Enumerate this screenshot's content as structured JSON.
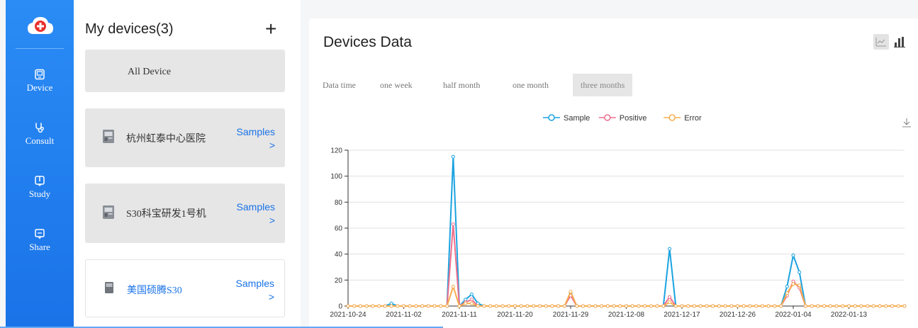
{
  "sidebar": {
    "items": [
      {
        "label": "Device",
        "icon": "device-icon"
      },
      {
        "label": "Consult",
        "icon": "stethoscope-icon"
      },
      {
        "label": "Study",
        "icon": "book-icon"
      },
      {
        "label": "Share",
        "icon": "share-icon"
      }
    ]
  },
  "devices": {
    "title": "My devices(3)",
    "add": "+",
    "all_label": "All Device",
    "items": [
      {
        "name": "杭州虹泰中心医院",
        "samples": "Samples",
        "arrow": ">"
      },
      {
        "name": "S30科宝研发1号机",
        "samples": "Samples",
        "arrow": ">"
      },
      {
        "name": "美国硕腾S30",
        "samples": "Samples",
        "arrow": ">"
      }
    ]
  },
  "panel": {
    "title": "Devices Data",
    "filter_label": "Data time",
    "filters": [
      "one week",
      "half month",
      "one month",
      "three months"
    ],
    "active_filter": "three months"
  },
  "colors": {
    "sample": "#1ba3e0",
    "positive": "#ee6f8d",
    "error": "#f6ad4e",
    "accent": "#1a73e8"
  },
  "chart_data": {
    "type": "line",
    "title": "",
    "xlabel": "",
    "ylabel": "",
    "ylim": [
      0,
      120
    ],
    "yticks": [
      0,
      20,
      40,
      60,
      80,
      100,
      120
    ],
    "x_start": "2021-10-24",
    "x_end": "2022-01-22",
    "xticks": [
      "2021-10-24",
      "2021-11-02",
      "2021-11-11",
      "2021-11-20",
      "2021-11-29",
      "2021-12-08",
      "2021-12-17",
      "2021-12-26",
      "2022-01-04",
      "2022-01-13"
    ],
    "legend_position": "top-center",
    "series": [
      {
        "name": "Sample",
        "points": [
          [
            "2021-10-30",
            0
          ],
          [
            "2021-10-31",
            2
          ],
          [
            "2021-11-01",
            0
          ],
          [
            "2021-11-09",
            0
          ],
          [
            "2021-11-10",
            115
          ],
          [
            "2021-11-11",
            0
          ],
          [
            "2021-11-12",
            5
          ],
          [
            "2021-11-13",
            9
          ],
          [
            "2021-11-14",
            2
          ],
          [
            "2021-11-15",
            0
          ],
          [
            "2021-11-28",
            0
          ],
          [
            "2021-11-29",
            10
          ],
          [
            "2021-11-30",
            0
          ],
          [
            "2021-12-14",
            0
          ],
          [
            "2021-12-15",
            44
          ],
          [
            "2021-12-16",
            0
          ],
          [
            "2022-01-02",
            0
          ],
          [
            "2022-01-03",
            15
          ],
          [
            "2022-01-04",
            39
          ],
          [
            "2022-01-05",
            26
          ],
          [
            "2022-01-06",
            0
          ]
        ]
      },
      {
        "name": "Positive",
        "points": [
          [
            "2021-11-09",
            0
          ],
          [
            "2021-11-10",
            63
          ],
          [
            "2021-11-11",
            0
          ],
          [
            "2021-11-12",
            3
          ],
          [
            "2021-11-13",
            5
          ],
          [
            "2021-11-14",
            0
          ],
          [
            "2021-11-28",
            0
          ],
          [
            "2021-11-29",
            8
          ],
          [
            "2021-11-30",
            0
          ],
          [
            "2021-12-14",
            0
          ],
          [
            "2021-12-15",
            7
          ],
          [
            "2021-12-16",
            0
          ],
          [
            "2022-01-02",
            0
          ],
          [
            "2022-01-03",
            8
          ],
          [
            "2022-01-04",
            19
          ],
          [
            "2022-01-05",
            14
          ],
          [
            "2022-01-06",
            0
          ]
        ]
      },
      {
        "name": "Error",
        "points": [
          [
            "2021-11-09",
            0
          ],
          [
            "2021-11-10",
            15
          ],
          [
            "2021-11-11",
            0
          ],
          [
            "2021-11-12",
            2
          ],
          [
            "2021-11-13",
            2
          ],
          [
            "2021-11-14",
            0
          ],
          [
            "2021-11-28",
            0
          ],
          [
            "2021-11-29",
            11
          ],
          [
            "2021-11-30",
            0
          ],
          [
            "2021-12-14",
            0
          ],
          [
            "2021-12-15",
            3
          ],
          [
            "2021-12-16",
            0
          ],
          [
            "2022-01-02",
            0
          ],
          [
            "2022-01-03",
            10
          ],
          [
            "2022-01-04",
            17
          ],
          [
            "2022-01-05",
            16
          ],
          [
            "2022-01-06",
            0
          ]
        ]
      }
    ]
  }
}
